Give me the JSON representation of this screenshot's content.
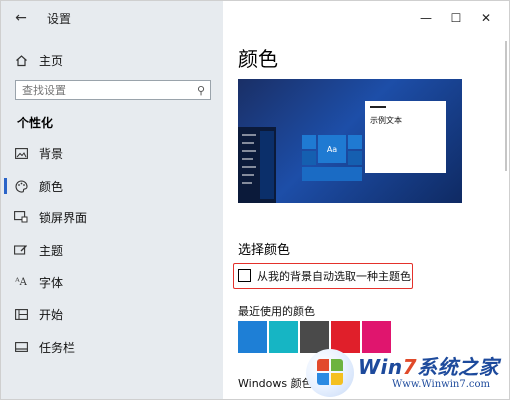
{
  "window": {
    "title": "设置",
    "controls": {
      "minimize": "—",
      "maximize": "☐",
      "close": "✕"
    }
  },
  "sidebar": {
    "home_label": "主页",
    "search_placeholder": "查找设置",
    "section_header": "个性化",
    "items": [
      {
        "label": "背景",
        "icon": "image-icon"
      },
      {
        "label": "颜色",
        "icon": "palette-icon",
        "active": true
      },
      {
        "label": "锁屏界面",
        "icon": "lock-screen-icon"
      },
      {
        "label": "主题",
        "icon": "theme-brush-icon"
      },
      {
        "label": "字体",
        "icon": "font-icon"
      },
      {
        "label": "开始",
        "icon": "start-grid-icon"
      },
      {
        "label": "任务栏",
        "icon": "taskbar-icon"
      }
    ]
  },
  "main": {
    "page_title": "颜色",
    "preview_sample_text": "示例文本",
    "preview_tile_text": "Aa",
    "choose_header": "选择颜色",
    "auto_pick_label": "从我的背景自动选取一种主题色",
    "auto_pick_checked": false,
    "recent_colors_label": "最近使用的颜色",
    "recent_colors": [
      "#1e7fd6",
      "#16b5c4",
      "#4a4a4a",
      "#e01f2a",
      "#e0156e"
    ],
    "windows_colors_label": "Windows 颜色"
  },
  "watermark": {
    "title_prefix": "Win",
    "title_seven": "7",
    "title_suffix": "系统之家",
    "url": "Www.Winwin7.com"
  },
  "colors": {
    "accent": "#2b64c8",
    "highlight_box": "#e4312b"
  }
}
